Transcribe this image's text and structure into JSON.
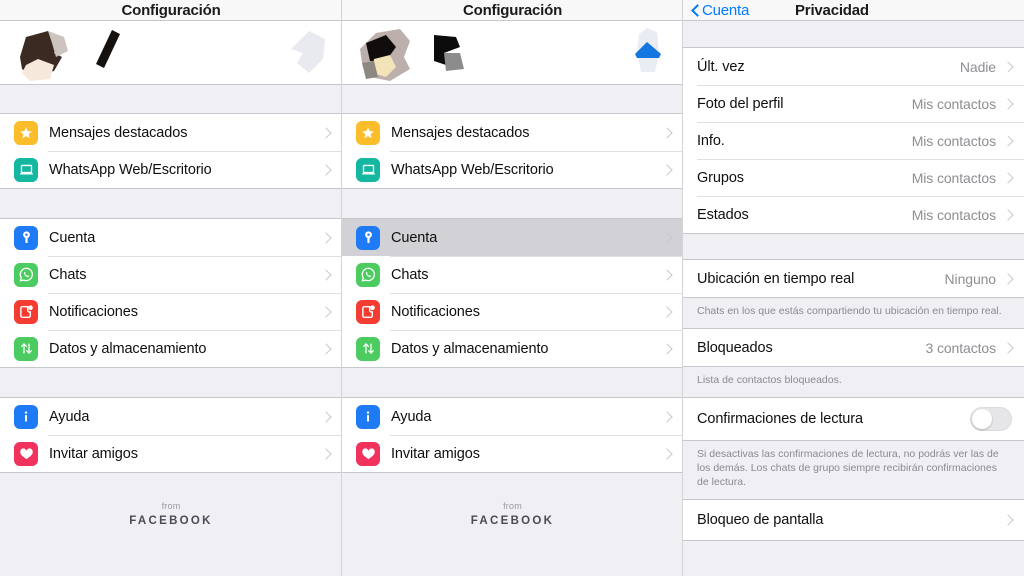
{
  "panels": {
    "left": {
      "nav": {
        "title": "Configuración"
      },
      "groups": [
        {
          "rows": [
            {
              "label": "Mensajes destacados",
              "icon": "star-icon",
              "color": "#fcbd2a"
            },
            {
              "label": "WhatsApp Web/Escritorio",
              "icon": "laptop-icon",
              "color": "#14b7a0"
            }
          ]
        },
        {
          "rows": [
            {
              "label": "Cuenta",
              "icon": "key-icon",
              "color": "#1f7bf5"
            },
            {
              "label": "Chats",
              "icon": "whatsapp-icon",
              "color": "#4ccc60"
            },
            {
              "label": "Notificaciones",
              "icon": "notification-icon",
              "color": "#f53c33"
            },
            {
              "label": "Datos y almacenamiento",
              "icon": "data-arrows-icon",
              "color": "#4ccc60"
            }
          ]
        },
        {
          "rows": [
            {
              "label": "Ayuda",
              "icon": "info-icon",
              "color": "#1f7bf5"
            },
            {
              "label": "Invitar amigos",
              "icon": "heart-icon",
              "color": "#f0325c"
            }
          ]
        }
      ],
      "footer": {
        "from": "from",
        "brand": "FACEBOOK"
      }
    },
    "middle": {
      "nav": {
        "title": "Configuración"
      },
      "groups": [
        {
          "rows": [
            {
              "label": "Mensajes destacados",
              "icon": "star-icon",
              "color": "#fcbd2a"
            },
            {
              "label": "WhatsApp Web/Escritorio",
              "icon": "laptop-icon",
              "color": "#14b7a0"
            }
          ]
        },
        {
          "rows": [
            {
              "label": "Cuenta",
              "icon": "key-icon",
              "color": "#1f7bf5",
              "selected": true
            },
            {
              "label": "Chats",
              "icon": "whatsapp-icon",
              "color": "#4ccc60"
            },
            {
              "label": "Notificaciones",
              "icon": "notification-icon",
              "color": "#f53c33"
            },
            {
              "label": "Datos y almacenamiento",
              "icon": "data-arrows-icon",
              "color": "#4ccc60"
            }
          ]
        },
        {
          "rows": [
            {
              "label": "Ayuda",
              "icon": "info-icon",
              "color": "#1f7bf5"
            },
            {
              "label": "Invitar amigos",
              "icon": "heart-icon",
              "color": "#f0325c"
            }
          ]
        }
      ],
      "footer": {
        "from": "from",
        "brand": "FACEBOOK"
      }
    },
    "right": {
      "nav": {
        "back_label": "Cuenta",
        "title": "Privacidad"
      },
      "group1": [
        {
          "label": "Últ. vez",
          "value": "Nadie"
        },
        {
          "label": "Foto del perfil",
          "value": "Mis contactos"
        },
        {
          "label": "Info.",
          "value": "Mis contactos"
        },
        {
          "label": "Grupos",
          "value": "Mis contactos"
        },
        {
          "label": "Estados",
          "value": "Mis contactos"
        }
      ],
      "live_location": {
        "label": "Ubicación en tiempo real",
        "value": "Ninguno"
      },
      "live_location_note": "Chats en los que estás compartiendo tu ubicación en tiempo real.",
      "blocked": {
        "label": "Bloqueados",
        "value": "3 contactos"
      },
      "blocked_note": "Lista de contactos bloqueados.",
      "read_receipts": {
        "label": "Confirmaciones de lectura",
        "state": "off"
      },
      "read_receipts_note": "Si desactivas las confirmaciones de lectura, no podrás ver las de los demás. Los chats de grupo siempre recibirán confirmaciones de lectura.",
      "screen_lock": {
        "label": "Bloqueo de pantalla"
      }
    }
  },
  "colors": {
    "accent_blue": "#007aff",
    "list_bg": "#efeff4",
    "row_bg": "#ffffff",
    "selected_row": "#d1d1d6",
    "secondary_text": "#8e8e93"
  }
}
